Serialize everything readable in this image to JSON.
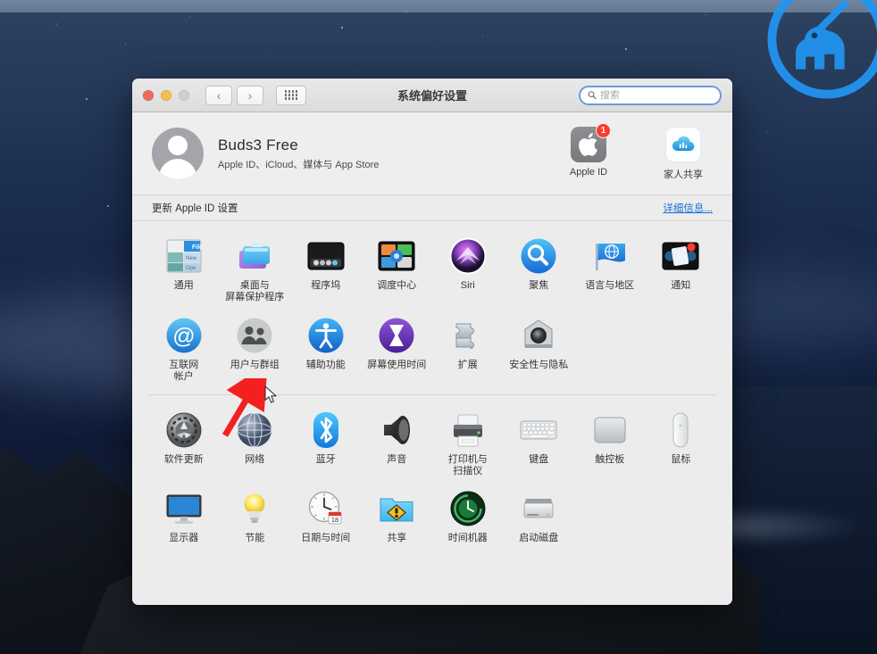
{
  "desktop": {
    "watermark_icon": "knight-horseback-logo",
    "watermark_color": "#2196f3",
    "wallpaper_name": "catalina-night-coast"
  },
  "window": {
    "title": "系统偏好设置",
    "traffic_lights": [
      {
        "name": "close",
        "color": "#ec6a5e"
      },
      {
        "name": "minimize",
        "color": "#f4bd4f"
      },
      {
        "name": "zoom",
        "color": "#cfcfcf"
      }
    ],
    "nav": {
      "back_icon": "chevron-left-icon",
      "back_label": "‹",
      "forward_icon": "chevron-right-icon",
      "forward_label": "›",
      "grid_icon": "show-all-grid-icon"
    },
    "search": {
      "icon": "search-icon",
      "placeholder": "搜索",
      "value": ""
    }
  },
  "account": {
    "avatar_icon": "user-avatar-icon",
    "name": "Buds3 Free",
    "subtitle": "Apple ID、iCloud、媒体与 App Store",
    "items": [
      {
        "label": "Apple ID",
        "icon": "apple-logo-icon",
        "badge": "1"
      },
      {
        "label": "家人共享",
        "icon": "family-sharing-cloud-icon",
        "badge": ""
      }
    ]
  },
  "update_banner": {
    "text": "更新 Apple ID 设置",
    "link": "详细信息..."
  },
  "panes": [
    {
      "id": "personal",
      "items": [
        {
          "label": "通用",
          "icon": "general-icon"
        },
        {
          "label": "桌面与\n屏幕保护程序",
          "icon": "desktop-screensaver-icon"
        },
        {
          "label": "程序坞",
          "icon": "dock-icon"
        },
        {
          "label": "调度中心",
          "icon": "mission-control-icon"
        },
        {
          "label": "Siri",
          "icon": "siri-icon"
        },
        {
          "label": "聚焦",
          "icon": "spotlight-icon"
        },
        {
          "label": "语言与地区",
          "icon": "language-region-icon"
        },
        {
          "label": "通知",
          "icon": "notifications-icon"
        },
        {
          "label": "互联网\n帐户",
          "icon": "internet-accounts-icon"
        },
        {
          "label": "用户与群组",
          "icon": "users-groups-icon"
        },
        {
          "label": "辅助功能",
          "icon": "accessibility-icon"
        },
        {
          "label": "屏幕使用时间",
          "icon": "screen-time-icon"
        },
        {
          "label": "扩展",
          "icon": "extensions-icon"
        },
        {
          "label": "安全性与隐私",
          "icon": "security-privacy-icon"
        }
      ]
    },
    {
      "id": "hardware",
      "items": [
        {
          "label": "软件更新",
          "icon": "software-update-icon"
        },
        {
          "label": "网络",
          "icon": "network-icon"
        },
        {
          "label": "蓝牙",
          "icon": "bluetooth-icon"
        },
        {
          "label": "声音",
          "icon": "sound-icon"
        },
        {
          "label": "打印机与\n扫描仪",
          "icon": "printers-scanners-icon"
        },
        {
          "label": "键盘",
          "icon": "keyboard-icon"
        },
        {
          "label": "触控板",
          "icon": "trackpad-icon"
        },
        {
          "label": "鼠标",
          "icon": "mouse-icon"
        },
        {
          "label": "显示器",
          "icon": "displays-icon"
        },
        {
          "label": "节能",
          "icon": "energy-saver-icon"
        },
        {
          "label": "日期与时间",
          "icon": "date-time-icon"
        },
        {
          "label": "共享",
          "icon": "sharing-icon"
        },
        {
          "label": "时间机器",
          "icon": "time-machine-icon"
        },
        {
          "label": "启动磁盘",
          "icon": "startup-disk-icon"
        }
      ]
    }
  ],
  "annotations": {
    "arrow": {
      "icon": "red-arrow-annotation",
      "color": "#f42020",
      "points_to": "用户与群组"
    },
    "cursor": {
      "icon": "mouse-pointer-icon"
    }
  }
}
